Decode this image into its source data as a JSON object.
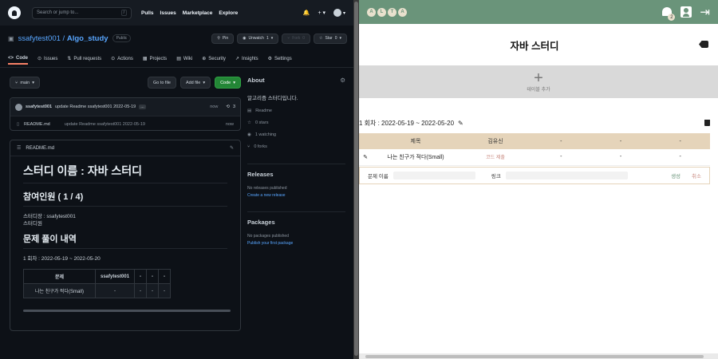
{
  "github": {
    "search_placeholder": "Search or jump to...",
    "search_key": "/",
    "nav": [
      "Pulls",
      "Issues",
      "Marketplace",
      "Explore"
    ],
    "top_icons": {
      "bell": "🔔",
      "plus": "+ ▾",
      "avatar_caret": "▾"
    },
    "repo": {
      "owner": "ssafytest001",
      "sep": "/",
      "name": "Algo_study",
      "visibility": "Public"
    },
    "repo_actions": {
      "pin": "Pin",
      "unwatch": "Unwatch",
      "unwatch_count": "1",
      "fork": "Fork",
      "fork_count": "0",
      "star": "Star",
      "star_count": "0"
    },
    "tabs": [
      "Code",
      "Issues",
      "Pull requests",
      "Actions",
      "Projects",
      "Wiki",
      "Security",
      "Insights",
      "Settings"
    ],
    "tab_icons": [
      "<>",
      "⊙",
      "⇅",
      "⊙",
      "▦",
      "▤",
      "⊕",
      "↗",
      "⚙"
    ],
    "branch": "main",
    "goto_file": "Go to file",
    "add_file": "Add file",
    "code_button": "Code",
    "commit": {
      "author": "ssafytest001",
      "message": "update Readme ssafytest001 2022-05-19",
      "more": "...",
      "time": "now",
      "history": "3"
    },
    "file_row": {
      "name": "README.md",
      "message": "update Readme ssafytest001 2022-05-19",
      "time": "now"
    },
    "readme_label": "README.md",
    "readme": {
      "h1": "스터디 이름 : 자바 스터디",
      "h2_members": "참여인원 ( 1 / 4)",
      "leader": "스터디장 : ssafytest001",
      "members_label": "스터디원",
      "h2_history": "문제 풀이 내역",
      "round": "1 회차 : 2022-05-19 ~ 2022-05-20",
      "table_headers": [
        "문제",
        "ssafytest001",
        "-",
        "-",
        "-"
      ],
      "table_row": [
        "나는 친구가 적다(Small)",
        "-",
        "-",
        "-",
        "-"
      ]
    },
    "about": {
      "title": "About",
      "description": "알고리즘 스터디입니다.",
      "meta": [
        {
          "icon": "▤",
          "text": "Readme"
        },
        {
          "icon": "☆",
          "text": "0 stars"
        },
        {
          "icon": "◉",
          "text": "1 watching"
        },
        {
          "icon": "⑂",
          "text": "0 forks"
        }
      ]
    },
    "releases": {
      "title": "Releases",
      "note": "No releases published",
      "link": "Create a new release"
    },
    "packages": {
      "title": "Packages",
      "note": "No packages published",
      "link": "Publish your first package"
    }
  },
  "alta": {
    "logo": [
      "A",
      "L",
      "T",
      "A"
    ],
    "notification_count": "2",
    "logout_icon": "⇥",
    "study_title": "자바 스터디",
    "add_table": {
      "plus": "+",
      "label": "테이블 추가"
    },
    "round": {
      "label": "1 회차 : 2022-05-19 ~ 2022-05-20",
      "edit_icon": "✎"
    },
    "table": {
      "headers": [
        "",
        "제목",
        "김유신",
        "-",
        "-",
        "-"
      ],
      "row": {
        "edit_icon": "✎",
        "title": "나는 친구가 적다(Small)",
        "code": "코드 제출",
        "c3": "-",
        "c4": "-",
        "c5": "-"
      }
    },
    "new_row": {
      "problem_label": "문제 이름",
      "link_label": "링크",
      "save": "생성",
      "cancel": "취소"
    }
  },
  "colors": {
    "github_bg": "#0d1117",
    "github_link": "#58a6ff",
    "github_green": "#238636",
    "alta_green": "#6a947a",
    "alta_beige": "#e5d4ba",
    "alta_pink": "#c98a80"
  }
}
